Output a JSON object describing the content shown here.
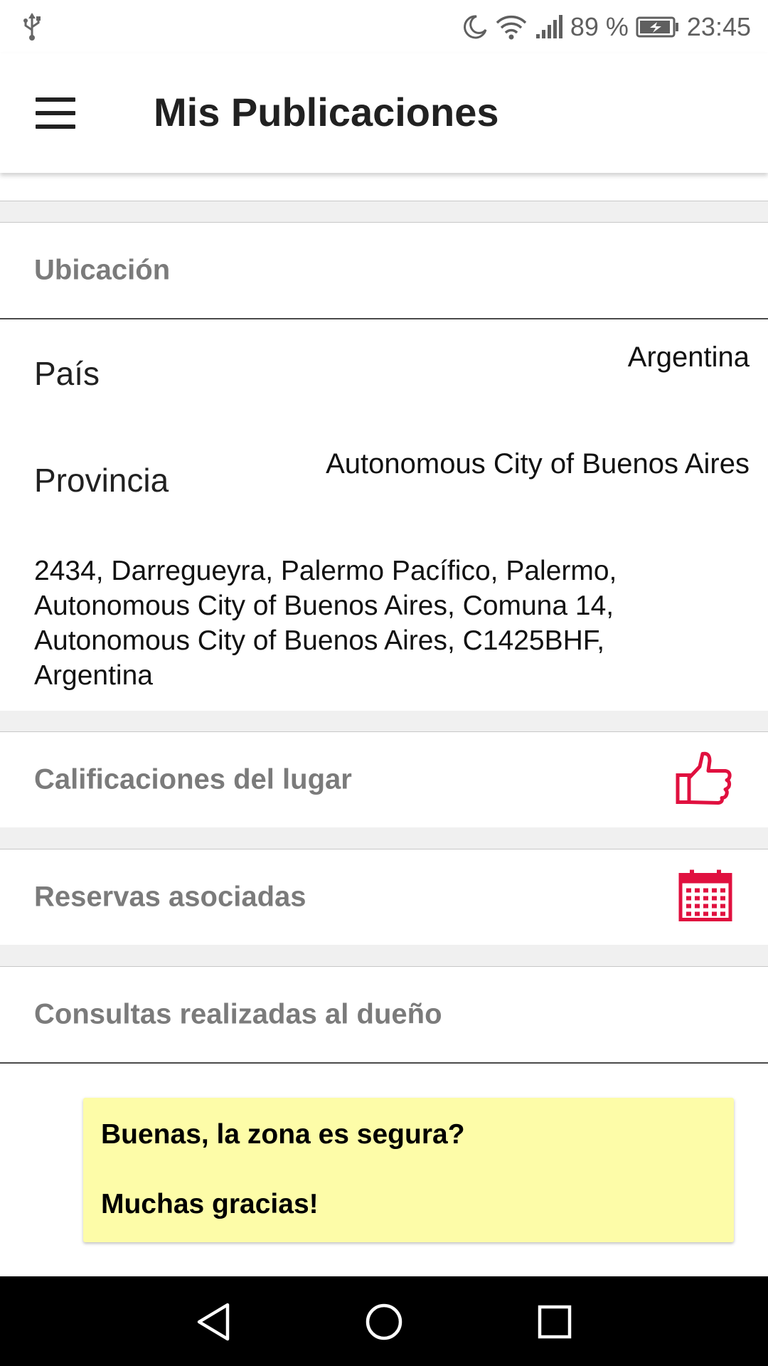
{
  "status_bar": {
    "battery_percent": "89 %",
    "time": "23:45",
    "icons": [
      "usb-icon",
      "moon-icon",
      "wifi-icon",
      "signal-icon",
      "battery-charging-icon"
    ]
  },
  "app_bar": {
    "title": "Mis Publicaciones",
    "menu_icon": "hamburger-menu-icon"
  },
  "ubicacion": {
    "header": "Ubicación",
    "pais_label": "País",
    "pais_value": "Argentina",
    "provincia_label": "Provincia",
    "provincia_value": "Autonomous City of Buenos Aires",
    "address_lines": [
      "2434, Darregueyra, Palermo Pacífico, Palermo,",
      "Autonomous City of Buenos Aires, Comuna 14,",
      "Autonomous City of Buenos Aires, C1425BHF,",
      "Argentina"
    ]
  },
  "calificaciones": {
    "header": "Calificaciones del lugar",
    "icon": "thumbs-up-icon"
  },
  "reservas": {
    "header": "Reservas asociadas",
    "icon": "calendar-icon"
  },
  "consultas": {
    "header": "Consultas realizadas al dueño",
    "messages": [
      {
        "line1": "Buenas, la zona es segura?",
        "line2": "Muchas gracias!"
      }
    ]
  },
  "colors": {
    "accent": "#e0103f",
    "note_background": "#fdfca8",
    "section_label": "#7b7b7b"
  },
  "nav_bar": {
    "buttons": [
      "back-icon",
      "home-icon",
      "recents-icon"
    ]
  }
}
